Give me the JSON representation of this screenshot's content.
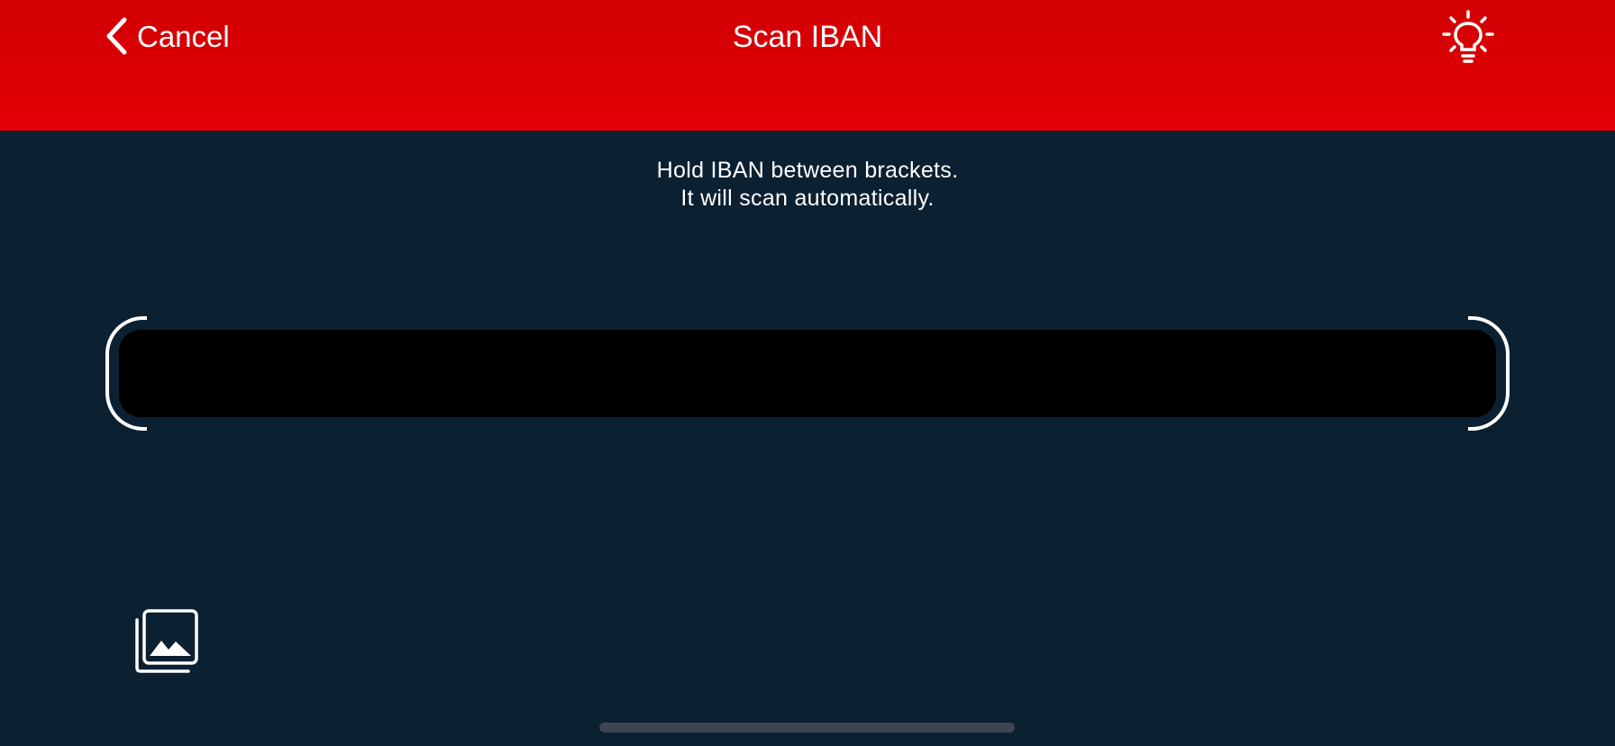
{
  "nav": {
    "back_label": "Cancel",
    "back_icon": "chevron-left-icon",
    "title": "Scan IBAN",
    "torch_icon": "lightbulb-icon"
  },
  "instructions": {
    "line1": "Hold IBAN between brackets.",
    "line2": "It will scan automatically."
  },
  "gallery": {
    "icon": "photo-library-icon"
  },
  "colors": {
    "nav_background": "#e30004",
    "page_background": "#0b2031",
    "scan_window": "#000000",
    "foreground": "#ffffff",
    "home_indicator": "#3d4650"
  }
}
